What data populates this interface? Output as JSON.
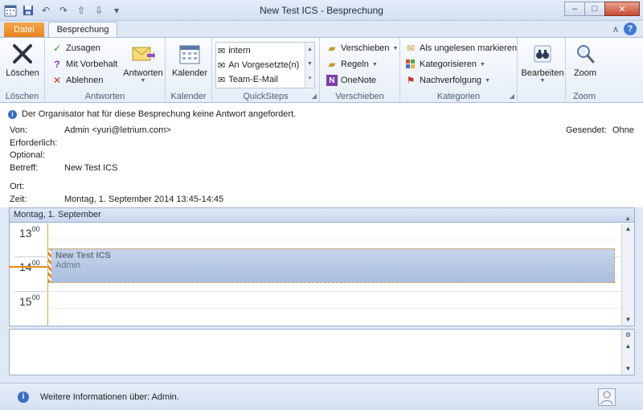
{
  "window": {
    "title": "New Test ICS  -  Besprechung",
    "minimize": "–",
    "maximize": "□",
    "close": "✕"
  },
  "tabs": {
    "file": "Datei",
    "active": "Besprechung",
    "help_arrow": "∧",
    "help": "?"
  },
  "ribbon": {
    "delete": {
      "label": "Löschen",
      "group": "Löschen"
    },
    "respond": {
      "accept": "Zusagen",
      "tentative": "Mit Vorbehalt",
      "decline": "Ablehnen",
      "respond": "Antworten",
      "group": "Antworten"
    },
    "calendar": {
      "label": "Kalender",
      "group": "Kalender"
    },
    "quicksteps": {
      "items": [
        "intern",
        "An Vorgesetzte(n)",
        "Team-E-Mail"
      ],
      "group": "QuickSteps"
    },
    "move": {
      "move": "Verschieben",
      "rules": "Regeln",
      "onenote": "OneNote",
      "group": "Verschieben"
    },
    "tags": {
      "unread": "Als ungelesen markieren",
      "categorize": "Kategorisieren",
      "followup": "Nachverfolgung",
      "group": "Kategorien"
    },
    "edit": {
      "label": "Bearbeiten"
    },
    "zoom": {
      "label": "Zoom",
      "group": "Zoom"
    }
  },
  "header": {
    "notice": "Der Organisator hat für diese Besprechung keine Antwort angefordert.",
    "from_label": "Von:",
    "from_value": "Admin <yuri@letrium.com>",
    "sent_label": "Gesendet:",
    "sent_value": "Ohne",
    "required_label": "Erforderlich:",
    "optional_label": "Optional:",
    "subject_label": "Betreff:",
    "subject_value": "New Test ICS",
    "location_label": "Ort:",
    "time_label": "Zeit:",
    "time_value": "Montag, 1. September 2014 13:45-14:45"
  },
  "calendar": {
    "day_header": "Montag, 1. September",
    "hours": [
      {
        "h": "13",
        "m": "00"
      },
      {
        "h": "14",
        "m": "00"
      },
      {
        "h": "15",
        "m": "00"
      }
    ],
    "event": {
      "title": "New Test ICS",
      "organizer": "Admin"
    }
  },
  "people_pane": {
    "text": "Weitere Informationen über: Admin."
  }
}
